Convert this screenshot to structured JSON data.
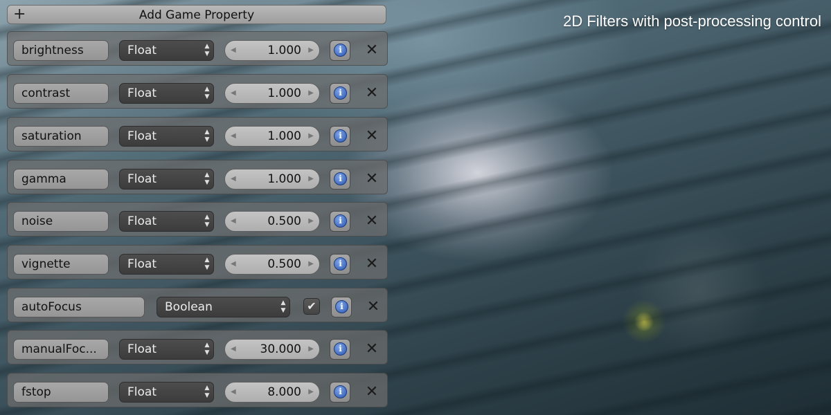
{
  "caption": "2D Filters with post-processing control",
  "add_button": {
    "icon": "plus-icon",
    "label": "Add Game Property"
  },
  "properties": [
    {
      "name": "brightness",
      "type": "Float",
      "value": "1.000"
    },
    {
      "name": "contrast",
      "type": "Float",
      "value": "1.000"
    },
    {
      "name": "saturation",
      "type": "Float",
      "value": "1.000"
    },
    {
      "name": "gamma",
      "type": "Float",
      "value": "1.000"
    },
    {
      "name": "noise",
      "type": "Float",
      "value": "0.500"
    },
    {
      "name": "vignette",
      "type": "Float",
      "value": "0.500"
    },
    {
      "name": "autoFocus",
      "type": "Boolean",
      "checked": true
    },
    {
      "name": "manualFoc...",
      "type": "Float",
      "value": "30.000"
    },
    {
      "name": "fstop",
      "type": "Float",
      "value": "8.000"
    }
  ],
  "icons": {
    "select_arrows": "up-down-arrows-icon",
    "info": "info-icon",
    "remove": "close-icon",
    "checkbox": "checkmark-icon"
  },
  "colors": {
    "panel_bg": "#6e6e6e",
    "type_select_bg": "#444444",
    "value_field_bg": "#bcbcbc",
    "info_icon_blue": "#2a55b0"
  }
}
